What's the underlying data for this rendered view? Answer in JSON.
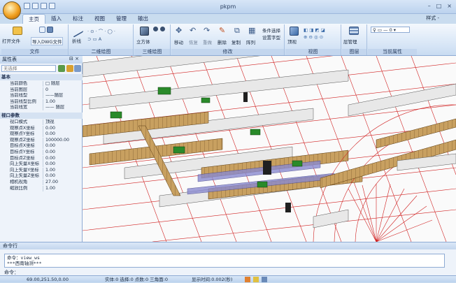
{
  "window": {
    "title": "pkpm",
    "controls": [
      "–",
      "□",
      "×"
    ]
  },
  "tabs": [
    "主页",
    "插入",
    "标注",
    "视图",
    "管理",
    "输出"
  ],
  "style_label": "样式 -",
  "ribbon": {
    "groups": [
      {
        "label": "文件",
        "buttons": [
          "打开文件",
          "导入DWG文件"
        ]
      },
      {
        "label": "二维绘图",
        "buttons": [
          "折线"
        ]
      },
      {
        "label": "三维绘图",
        "buttons": [
          "立方体"
        ]
      },
      {
        "label": "修改",
        "buttons": [
          "移动",
          "恢复",
          "重做",
          "删除",
          "复制",
          "阵列",
          "条件选择",
          "设置字型"
        ]
      },
      {
        "label": "视图",
        "buttons": [
          "顶视"
        ]
      },
      {
        "label": "图层",
        "buttons": [
          "层管理"
        ]
      },
      {
        "label": "当前属性",
        "buttons": []
      }
    ]
  },
  "properties": {
    "title": "属性表",
    "selector": "无选择",
    "sections": [
      {
        "name": "基本",
        "rows": [
          [
            "当前颜色",
            "□ 随层"
          ],
          [
            "当前图层",
            "0"
          ],
          [
            "当前线型",
            "——随层"
          ],
          [
            "当前线型比例",
            "1.00"
          ],
          [
            "当前线宽",
            "—— 随层"
          ]
        ]
      },
      {
        "name": "视口参数",
        "rows": [
          [
            "视口模式",
            "顶视"
          ],
          [
            "观察点X坐标",
            "0.00"
          ],
          [
            "观察点Y坐标",
            "0.00"
          ],
          [
            "观察点Z坐标",
            "100000.00"
          ],
          [
            "目标点X坐标",
            "0.00"
          ],
          [
            "目标点Y坐标",
            "0.00"
          ],
          [
            "目标点Z坐标",
            "0.00"
          ],
          [
            "向上矢量X坐标",
            "0.00"
          ],
          [
            "向上矢量Y坐标",
            "1.00"
          ],
          [
            "向上矢量Z坐标",
            "0.00"
          ],
          [
            "相机视角",
            "27.00"
          ],
          [
            "缩放比例",
            "1.00"
          ]
        ]
      }
    ]
  },
  "command": {
    "title": "命令行",
    "lines": [
      "命令：view_ws",
      "***西南轴测***"
    ],
    "prompt": "命令："
  },
  "status": {
    "coords": "69.00,251.50,0.00",
    "info": "实体:0 选择:0 点数:0 三角面:0",
    "time": "显示时间:0.002(秒)"
  }
}
